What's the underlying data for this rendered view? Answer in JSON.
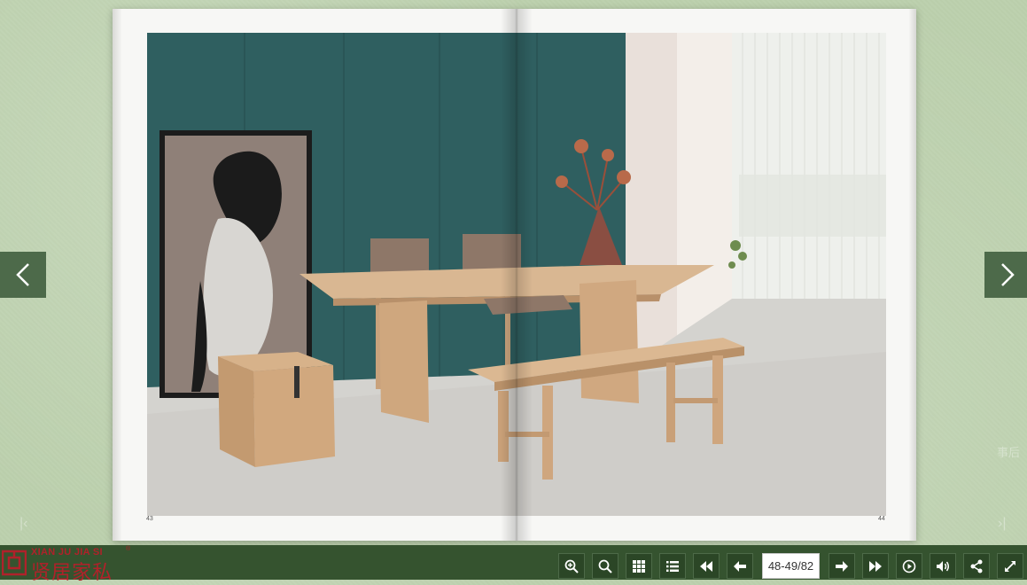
{
  "book": {
    "left_page_number": "43",
    "right_page_number": "44"
  },
  "navigation": {
    "prev_icon": "chevron-left-icon",
    "next_icon": "chevron-right-icon"
  },
  "faint_overlay": {
    "text": "事后"
  },
  "brand": {
    "name_en": "XIAN JU JIA SI",
    "name_cn": "贤居家私",
    "registered": "®",
    "color": "#b0212a"
  },
  "toolbar": {
    "background": "#35532f",
    "page_indicator": "48-49/82",
    "buttons": [
      {
        "name": "zoom-in",
        "icon": "zoom-in-icon"
      },
      {
        "name": "search",
        "icon": "search-icon"
      },
      {
        "name": "thumbnails",
        "icon": "grid-icon"
      },
      {
        "name": "table-of-contents",
        "icon": "list-icon"
      },
      {
        "name": "first-page",
        "icon": "double-left-icon"
      },
      {
        "name": "previous-page",
        "icon": "arrow-left-icon"
      },
      {
        "name": "next-page",
        "icon": "arrow-right-icon"
      },
      {
        "name": "last-page",
        "icon": "double-right-icon"
      },
      {
        "name": "autoplay",
        "icon": "play-icon"
      },
      {
        "name": "sound",
        "icon": "speaker-icon"
      },
      {
        "name": "share",
        "icon": "share-icon"
      },
      {
        "name": "fullscreen",
        "icon": "fullscreen-icon"
      }
    ]
  }
}
